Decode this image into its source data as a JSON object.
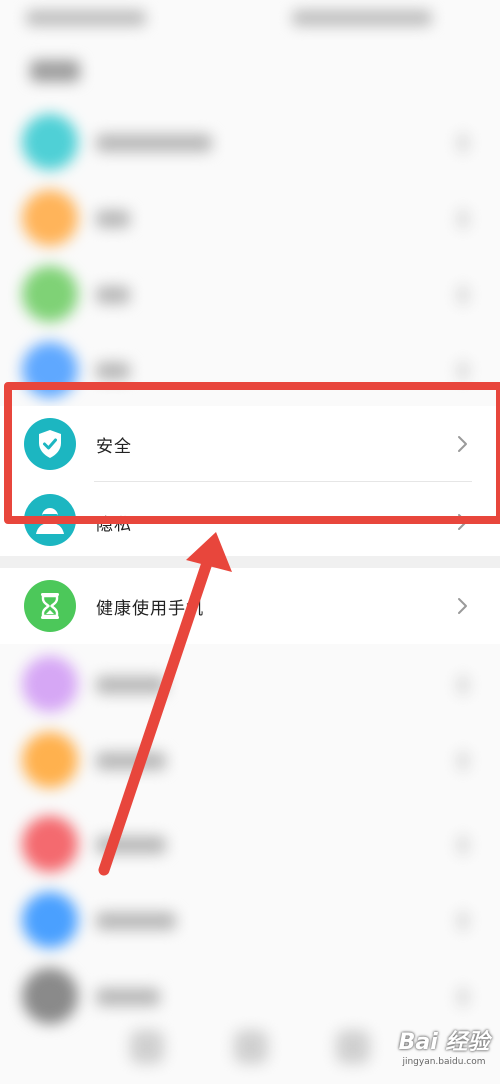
{
  "colors": {
    "accent_teal": "#1cb6c1",
    "highlight_red": "#e8463c",
    "health_green": "#4cc85a",
    "text_primary": "#222222",
    "chevron_gray": "#9a9a9a"
  },
  "settings_list": {
    "items": [
      {
        "label": "安全",
        "icon": "shield-check-icon",
        "highlighted": true
      },
      {
        "label": "隐私",
        "icon": "privacy-person-icon",
        "highlighted": false
      },
      {
        "label": "健康使用手机",
        "icon": "hourglass-icon",
        "highlighted": false
      }
    ],
    "blurred_items": [
      {
        "label": "存储",
        "icon": "storage-icon"
      }
    ]
  },
  "watermark": {
    "main": "Bai 经验",
    "sub": "jingyan.baidu.com"
  }
}
